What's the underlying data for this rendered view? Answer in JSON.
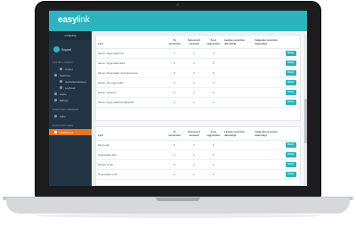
{
  "app": {
    "logo_bold": "easy",
    "logo_rest": "link"
  },
  "sidebar": {
    "company": "company",
    "user": "Support",
    "groups": [
      {
        "label": "INSTELLINGEN",
        "items": [
          {
            "label": "Profiel",
            "icon": "user-icon",
            "sub": true
          },
          {
            "label": "Telefonie",
            "icon": "phone-icon",
            "sub": false
          },
          {
            "label": "Gebruikersbeheer",
            "icon": "users-icon",
            "sub": true
          },
          {
            "label": "Logboek",
            "icon": "list-icon",
            "sub": true
          },
          {
            "label": "Audio",
            "icon": "audio-icon",
            "sub": false
          },
          {
            "label": "Beheer",
            "icon": "gear-icon",
            "sub": false
          }
        ]
      },
      {
        "label": "DIENSTEN BEHEER",
        "items": [
          {
            "label": "Zoho",
            "icon": "link-icon",
            "sub": false
          }
        ]
      },
      {
        "label": "RAPPORTAGES",
        "items": [
          {
            "label": "Dashboard",
            "icon": "chart-icon",
            "sub": false,
            "active": true
          }
        ]
      }
    ]
  },
  "table1": {
    "headers": [
      "Lijst",
      "Te verwerken",
      "Succesvol verwerkt",
      "Fout opgetreden",
      "Laatste recentste datum/tijd",
      "Volgende recentste datum/tijd",
      ""
    ],
    "rows": [
      {
        "name": "Nieuw: Opgemaakt kort",
        "a": "0",
        "b": "1",
        "c": "0",
        "action": "Bekijk"
      },
      {
        "name": "Nieuw: Opgemaakt alles",
        "a": "0",
        "b": "1",
        "c": "0",
        "action": "Bekijk"
      },
      {
        "name": "Nieuw: Opgemaakt contactpersonen",
        "a": "0",
        "b": "1",
        "c": "0",
        "action": "Bekijk"
      },
      {
        "name": "Nieuw: niet opgemaakt",
        "a": "0",
        "b": "1",
        "c": "0",
        "action": "Bekijk"
      },
      {
        "name": "Nieuw: verleend",
        "a": "0",
        "b": "1",
        "c": "0",
        "action": "Bekijk"
      },
      {
        "name": "Nieuw: Opgemaakt bedrijfsadres",
        "a": "0",
        "b": "1",
        "c": "0",
        "action": "Bekijk"
      }
    ]
  },
  "table2": {
    "headers": [
      "Lijst",
      "Te verwerken",
      "Succesvol verwerkt",
      "Fout opgetreden",
      "Laatste recentste datum/tijd",
      "Volgende recentste datum/tijd",
      ""
    ],
    "rows": [
      {
        "name": "Nieuw alle",
        "a": "0",
        "b": "1",
        "c": "0",
        "action": "Bekijk"
      },
      {
        "name": "Opgemaakt alles",
        "a": "0",
        "b": "1",
        "c": "0",
        "action": "Bekijk"
      },
      {
        "name": "Nieuwe onder",
        "a": "0",
        "b": "1",
        "c": "0",
        "action": "Bekijk"
      },
      {
        "name": "Opgemaakt onder",
        "a": "0",
        "b": "1",
        "c": "0",
        "action": "Bekijk"
      }
    ]
  }
}
